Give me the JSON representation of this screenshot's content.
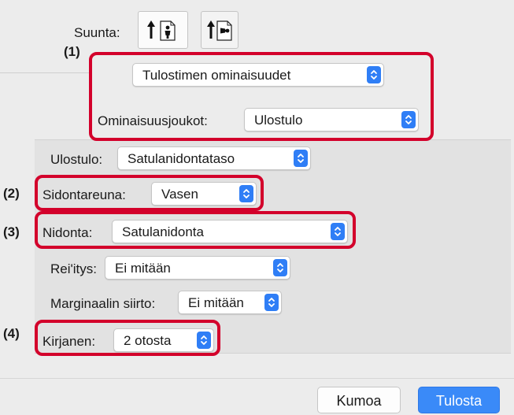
{
  "orientation": {
    "label": "Suunta:"
  },
  "callouts": {
    "n1": "(1)",
    "n2": "(2)",
    "n3": "(3)",
    "n4": "(4)"
  },
  "printer_menu": {
    "value": "Tulostimen ominaisuudet"
  },
  "feature_sets": {
    "label": "Ominaisuusjoukot:",
    "value": "Ulostulo"
  },
  "output": {
    "label": "Ulostulo:",
    "value": "Satulanidontataso"
  },
  "binding_edge": {
    "label": "Sidontareuna:",
    "value": "Vasen"
  },
  "stapling": {
    "label": "Nidonta:",
    "value": "Satulanidonta"
  },
  "punch": {
    "label": "Rei'itys:",
    "value": "Ei mitään"
  },
  "margin_shift": {
    "label": "Marginaalin siirto:",
    "value": "Ei mitään"
  },
  "booklet": {
    "label": "Kirjanen:",
    "value": "2 otosta"
  },
  "buttons": {
    "cancel": "Kumoa",
    "print": "Tulosta"
  },
  "colors": {
    "accent": "#2f7ef6",
    "highlight": "#d3002b"
  }
}
